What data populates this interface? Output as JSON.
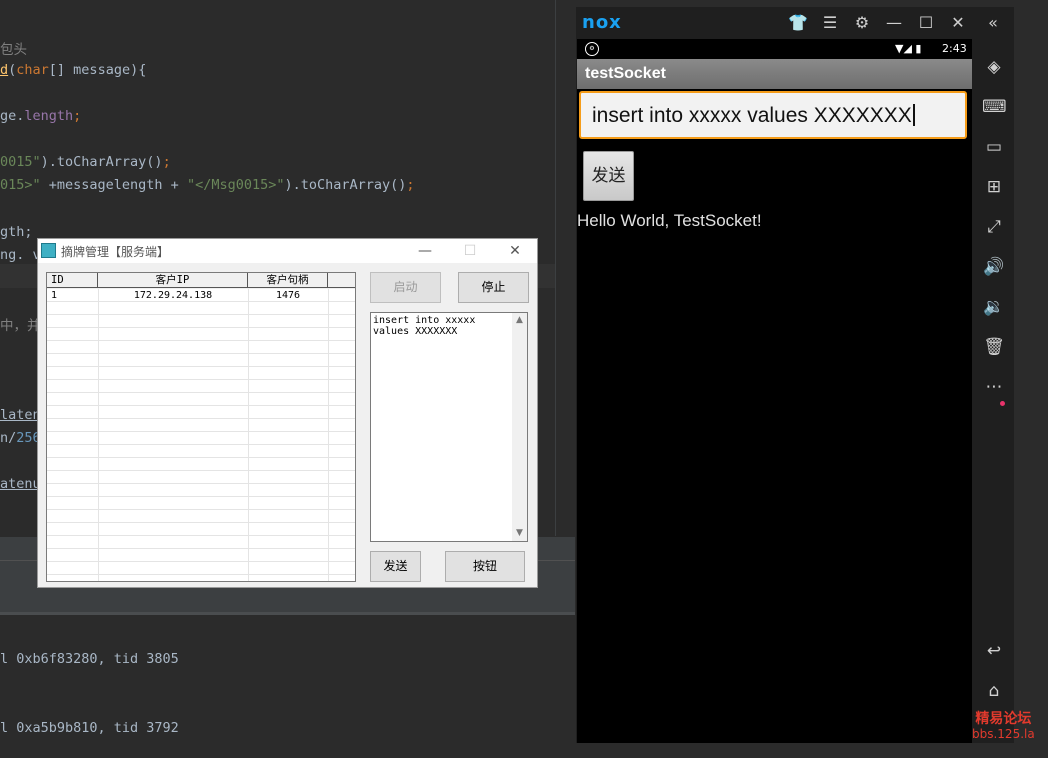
{
  "editor": {
    "lines": [
      {
        "parts": [
          {
            "t": "包头",
            "c": "cmt"
          }
        ]
      },
      {
        "parts": [
          {
            "t": "d",
            "c": "fn ul"
          },
          {
            "t": "(",
            "c": ""
          },
          {
            "t": "char",
            "c": "kw"
          },
          {
            "t": "[] message){",
            "c": ""
          }
        ]
      },
      {
        "parts": [
          {
            "t": "ge.",
            "c": ""
          },
          {
            "t": "length",
            "c": "fld"
          },
          {
            "t": ";",
            "c": "kw"
          }
        ]
      },
      {
        "parts": [
          {
            "t": "0015\"",
            "c": "str"
          },
          {
            "t": ").toCharArray()",
            "c": ""
          },
          {
            "t": ";",
            "c": "kw"
          }
        ]
      },
      {
        "parts": [
          {
            "t": "015>\"",
            "c": "str"
          },
          {
            "t": " +messagelength + ",
            "c": ""
          },
          {
            "t": "\"</Msg0015>\"",
            "c": "str"
          },
          {
            "t": ").toCharArray()",
            "c": ""
          },
          {
            "t": ";",
            "c": "kw"
          }
        ]
      },
      {
        "parts": [
          {
            "t": "gth;",
            "c": ""
          }
        ]
      },
      {
        "parts": [
          {
            "t": "ng. v",
            "c": ""
          }
        ]
      },
      {
        "parts": [
          {
            "t": "中，并",
            "c": "cmt"
          }
        ]
      },
      {
        "parts": [
          {
            "t": "latenu",
            "c": "ul"
          }
        ]
      },
      {
        "parts": [
          {
            "t": "n/",
            "c": ""
          },
          {
            "t": "256",
            "c": "num"
          }
        ]
      },
      {
        "parts": [
          {
            "t": "atenum",
            "c": "ul"
          }
        ]
      }
    ]
  },
  "console": {
    "lines": [
      "l 0xb6f83280, tid 3805",
      "l 0xa5b9b810, tid 3792"
    ]
  },
  "nox": {
    "logo": "nox",
    "title_icons": [
      "shirt-icon",
      "menu-icon",
      "gear-icon",
      "minimize-icon",
      "maximize-icon",
      "close-icon",
      "collapse-icon"
    ],
    "side_icons": [
      "rotate-icon",
      "keyboard-icon",
      "screen-icon",
      "apk-icon",
      "fullscreen-icon",
      "volume-up-icon",
      "volume-down-icon",
      "delete-icon",
      "more-icon",
      "back-icon",
      "home-icon"
    ],
    "status_time": "2:43",
    "app_title": "testSocket",
    "input_value": "insert into xxxxx values XXXXXXX",
    "send_label": "发送",
    "hello_text": "Hello World, TestSocket!"
  },
  "dialog": {
    "title": "摘牌管理【服务端】",
    "columns": [
      "ID",
      "客户IP",
      "客户句柄"
    ],
    "rows": [
      {
        "id": "1",
        "ip": "172.29.24.138",
        "handle": "1476"
      }
    ],
    "start_label": "启动",
    "stop_label": "停止",
    "memo_text": "insert into xxxxx\nvalues XXXXXXX",
    "send_label": "发送",
    "button_label": "按钮"
  },
  "watermark": {
    "line1": "精易论坛",
    "line2": "bbs.125.la"
  },
  "colors": {
    "accent_orange": "#f59c19",
    "nox_blue": "#1aa1f1",
    "ide_bg": "#2b2b2b"
  }
}
